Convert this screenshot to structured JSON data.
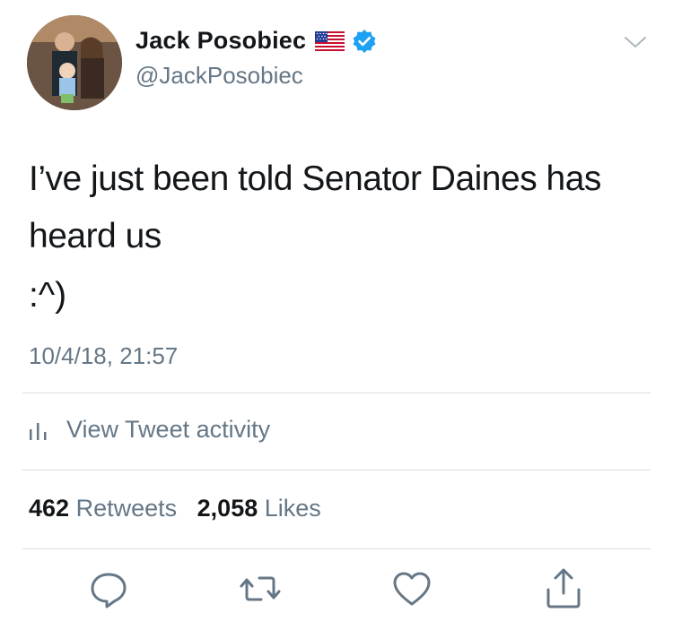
{
  "author": {
    "name": "Jack Posobiec",
    "handle": "@JackPosobiec",
    "verified": true,
    "flag_emoji": "us-flag-icon"
  },
  "tweet": {
    "text": "I’ve just been told Senator Daines has heard us",
    "emote": ":^)",
    "timestamp": "10/4/18, 21:57"
  },
  "activity": {
    "label": "View Tweet activity"
  },
  "stats": {
    "retweets_count": "462",
    "retweets_label": "Retweets",
    "likes_count": "2,058",
    "likes_label": "Likes"
  },
  "actions": [
    "reply-icon",
    "retweet-icon",
    "like-icon",
    "share-icon"
  ],
  "colors": {
    "text": "#14171a",
    "secondary": "#657786",
    "divider": "#d8dde2",
    "verified_blue": "#1da1f2"
  }
}
